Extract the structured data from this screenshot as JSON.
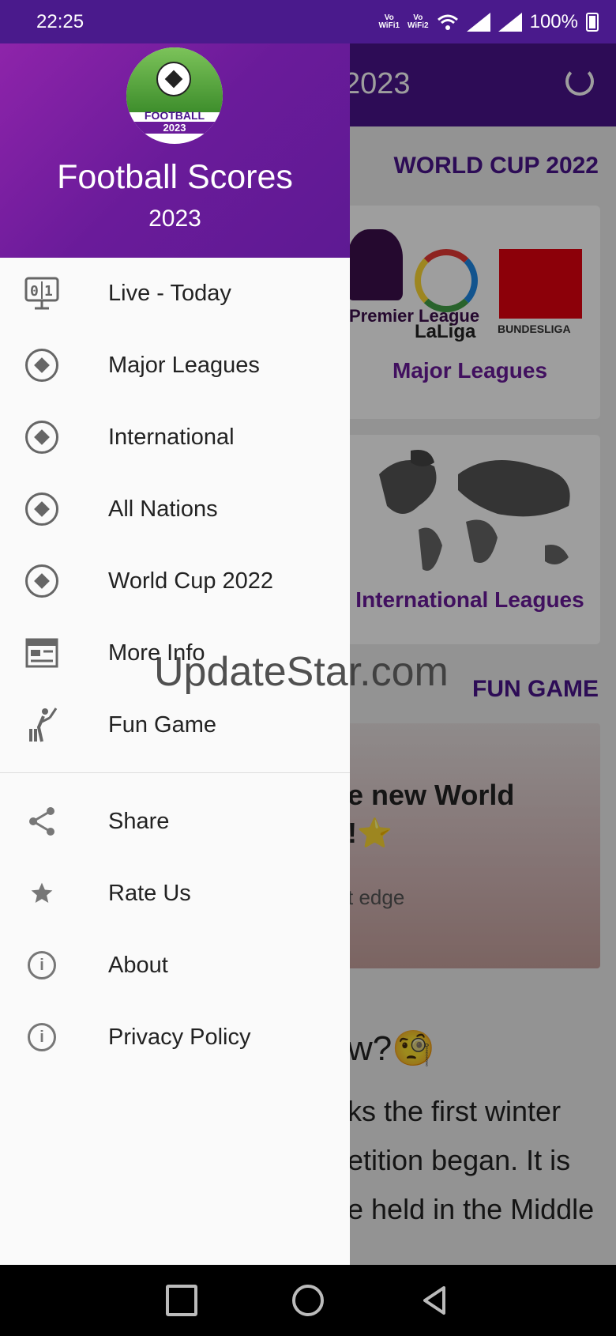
{
  "status_bar": {
    "time": "22:25",
    "vo1": "Vo",
    "wifi1": "WiFi1",
    "vo2": "Vo",
    "wifi2": "WiFi2",
    "battery": "100%"
  },
  "background": {
    "toolbar_title": "2023",
    "section_world_cup": "WORLD CUP 2022",
    "card_major_leagues": "Major Leagues",
    "premier_league": "Premier League",
    "laliga": "LaLiga",
    "bundesliga": "BUNDESLIGA",
    "card_international": "International Leagues",
    "section_fun_game": "FUN GAME",
    "fun_game_line1": "e new World",
    "fun_game_line2": "!⭐",
    "fun_game_line3": "t edge",
    "text_line1": "w?🧐",
    "text_line2": "ks the first winter",
    "text_line3": "etition began. It is",
    "text_line4": "e held in the Middle"
  },
  "drawer": {
    "logo_line1": "FOOTBALL",
    "logo_line2": "2023",
    "app_name": "Football Scores",
    "app_year": "2023",
    "items": [
      {
        "label": "Live - Today",
        "icon": "scoreboard-icon"
      },
      {
        "label": "Major Leagues",
        "icon": "soccer-ball-icon"
      },
      {
        "label": "International",
        "icon": "soccer-ball-icon"
      },
      {
        "label": "All Nations",
        "icon": "soccer-ball-icon"
      },
      {
        "label": "World Cup 2022",
        "icon": "soccer-ball-icon"
      },
      {
        "label": "More Info",
        "icon": "news-icon"
      },
      {
        "label": "Fun Game",
        "icon": "cricket-icon"
      }
    ],
    "secondary_items": [
      {
        "label": "Share",
        "icon": "share-icon"
      },
      {
        "label": "Rate Us",
        "icon": "star-icon"
      },
      {
        "label": "About",
        "icon": "info-icon"
      },
      {
        "label": "Privacy Policy",
        "icon": "info-icon"
      }
    ]
  },
  "watermark": "UpdateStar.com"
}
